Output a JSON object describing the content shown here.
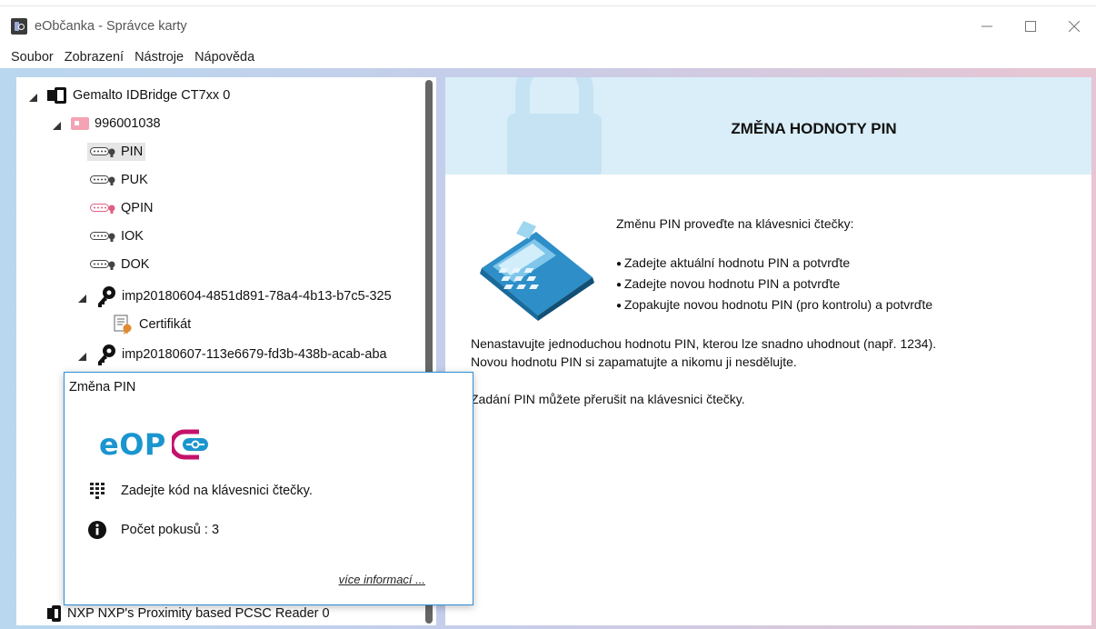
{
  "window": {
    "title": "eObčanka - Správce karty",
    "controls": [
      "minimize-icon",
      "maximize-icon",
      "close-icon"
    ]
  },
  "menu": {
    "items": [
      "Soubor",
      "Zobrazení",
      "Nástroje",
      "Nápověda"
    ]
  },
  "tree": {
    "reader": "Gemalto IDBridge CT7xx 0",
    "card": "996001038",
    "pins": [
      "PIN",
      "PUK",
      "QPIN",
      "IOK",
      "DOK"
    ],
    "cert_group_1": "imp20180604-4851d891-78a4-4b13-b7c5-325",
    "cert_1": "Certifikát",
    "cert_group_2": "imp20180607-113e6679-fd3b-438b-acab-aba",
    "reader_2": "NXP NXP's Proximity based PCSC Reader 0",
    "selected_item": "PIN"
  },
  "content": {
    "banner_title": "ZMĚNA HODNOTY PIN",
    "intro": "Změnu PIN proveďte na klávesnici čtečky:",
    "steps": [
      "Zadejte aktuální hodnotu PIN a potvrďte",
      "Zadejte novou hodnotu PIN a potvrďte",
      "Zopakujte novou hodnotu PIN (pro kontrolu) a potvrďte"
    ],
    "warning_line1": "Nenastavujte jednoduchou hodnotu PIN, kterou lze snadno uhodnout (např. 1234).",
    "warning_line2": "Novou hodnotu PIN si zapamatujte a nikomu ji nesdělujte.",
    "interrupt": "Zadání PIN můžete přerušit na klávesnici čtečky."
  },
  "dialog": {
    "title": "Změna PIN",
    "logo_text": "eOP",
    "prompt": "Zadejte kód na klávesnici čtečky.",
    "attempts": "Počet pokusů : 3",
    "more_info": "více informací ..."
  },
  "colors": {
    "banner_bg": "#d9eef8",
    "dialog_border": "#2c8ed8",
    "logo_blue": "#1b95cf",
    "logo_magenta": "#c4126b"
  }
}
